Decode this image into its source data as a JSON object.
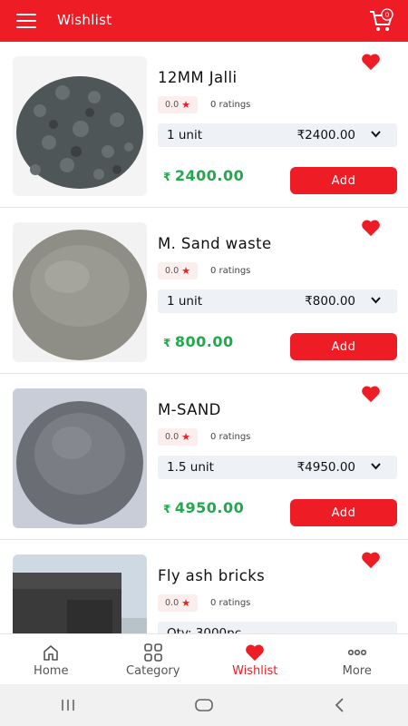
{
  "appbar": {
    "title": "Wishlist",
    "cart_count": "0"
  },
  "products": [
    {
      "name": "12MM Jalli",
      "rating": "0.0",
      "ratings_text": "0 ratings",
      "unit": "1 unit",
      "unit_price": "₹2400.00",
      "price": "2400.00",
      "currency": "₹",
      "add_label": "Add",
      "img_color": "#4f5658"
    },
    {
      "name": "M. Sand waste",
      "rating": "0.0",
      "ratings_text": "0 ratings",
      "unit": "1 unit",
      "unit_price": "₹800.00",
      "price": "800.00",
      "currency": "₹",
      "add_label": "Add",
      "img_color": "#8e8e86"
    },
    {
      "name": "M-SAND",
      "rating": "0.0",
      "ratings_text": "0 ratings",
      "unit": "1.5 unit",
      "unit_price": "₹4950.00",
      "price": "4950.00",
      "currency": "₹",
      "add_label": "Add",
      "img_color": "#6a6d73"
    },
    {
      "name": "Fly ash bricks",
      "rating": "0.0",
      "ratings_text": "0 ratings",
      "unit": "Qty: 3000pc",
      "unit_price": "",
      "price": "",
      "currency": "",
      "add_label": "",
      "img_color": "#3a3a3a"
    }
  ],
  "bottom_nav": [
    {
      "label": "Home",
      "icon": "home-icon"
    },
    {
      "label": "Category",
      "icon": "grid-icon"
    },
    {
      "label": "Wishlist",
      "icon": "heart-icon"
    },
    {
      "label": "More",
      "icon": "more-icon"
    }
  ],
  "colors": {
    "primary": "#ee1c25",
    "price_green": "#1faa4b"
  }
}
